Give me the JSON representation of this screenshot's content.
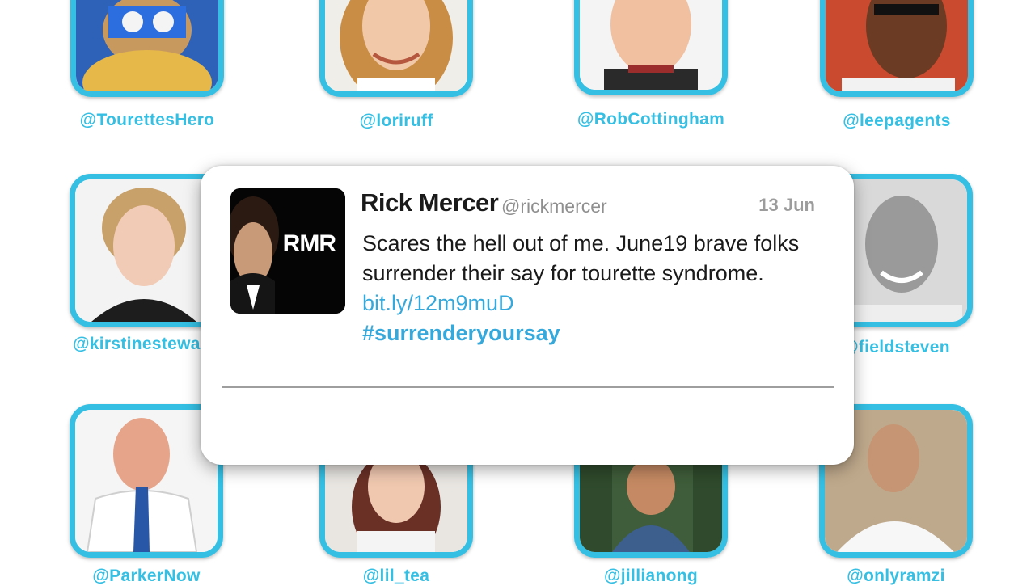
{
  "profiles": [
    {
      "handle": "@TourettesHero"
    },
    {
      "handle": "@loriruff"
    },
    {
      "handle": "@RobCottingham"
    },
    {
      "handle": "@leepagents"
    },
    {
      "handle": "@kirstinestewa"
    },
    {
      "handle": "@fieldsteven"
    },
    {
      "handle": "@ParkerNow"
    },
    {
      "handle": "@lil_tea"
    },
    {
      "handle": "@jillianong"
    },
    {
      "handle": "@onlyramzi"
    }
  ],
  "tweet": {
    "avatar_text": "RMR",
    "name": "Rick Mercer",
    "handle": "@rickmercer",
    "date": "13 Jun",
    "text": "Scares the hell out of me. June19 brave folks surrender their say for tourette syndrome.",
    "link": "bit.ly/12m9muD",
    "hashtag": "#surrenderyoursay"
  },
  "colors": {
    "accent": "#35bfe3",
    "link": "#35a9dc"
  }
}
